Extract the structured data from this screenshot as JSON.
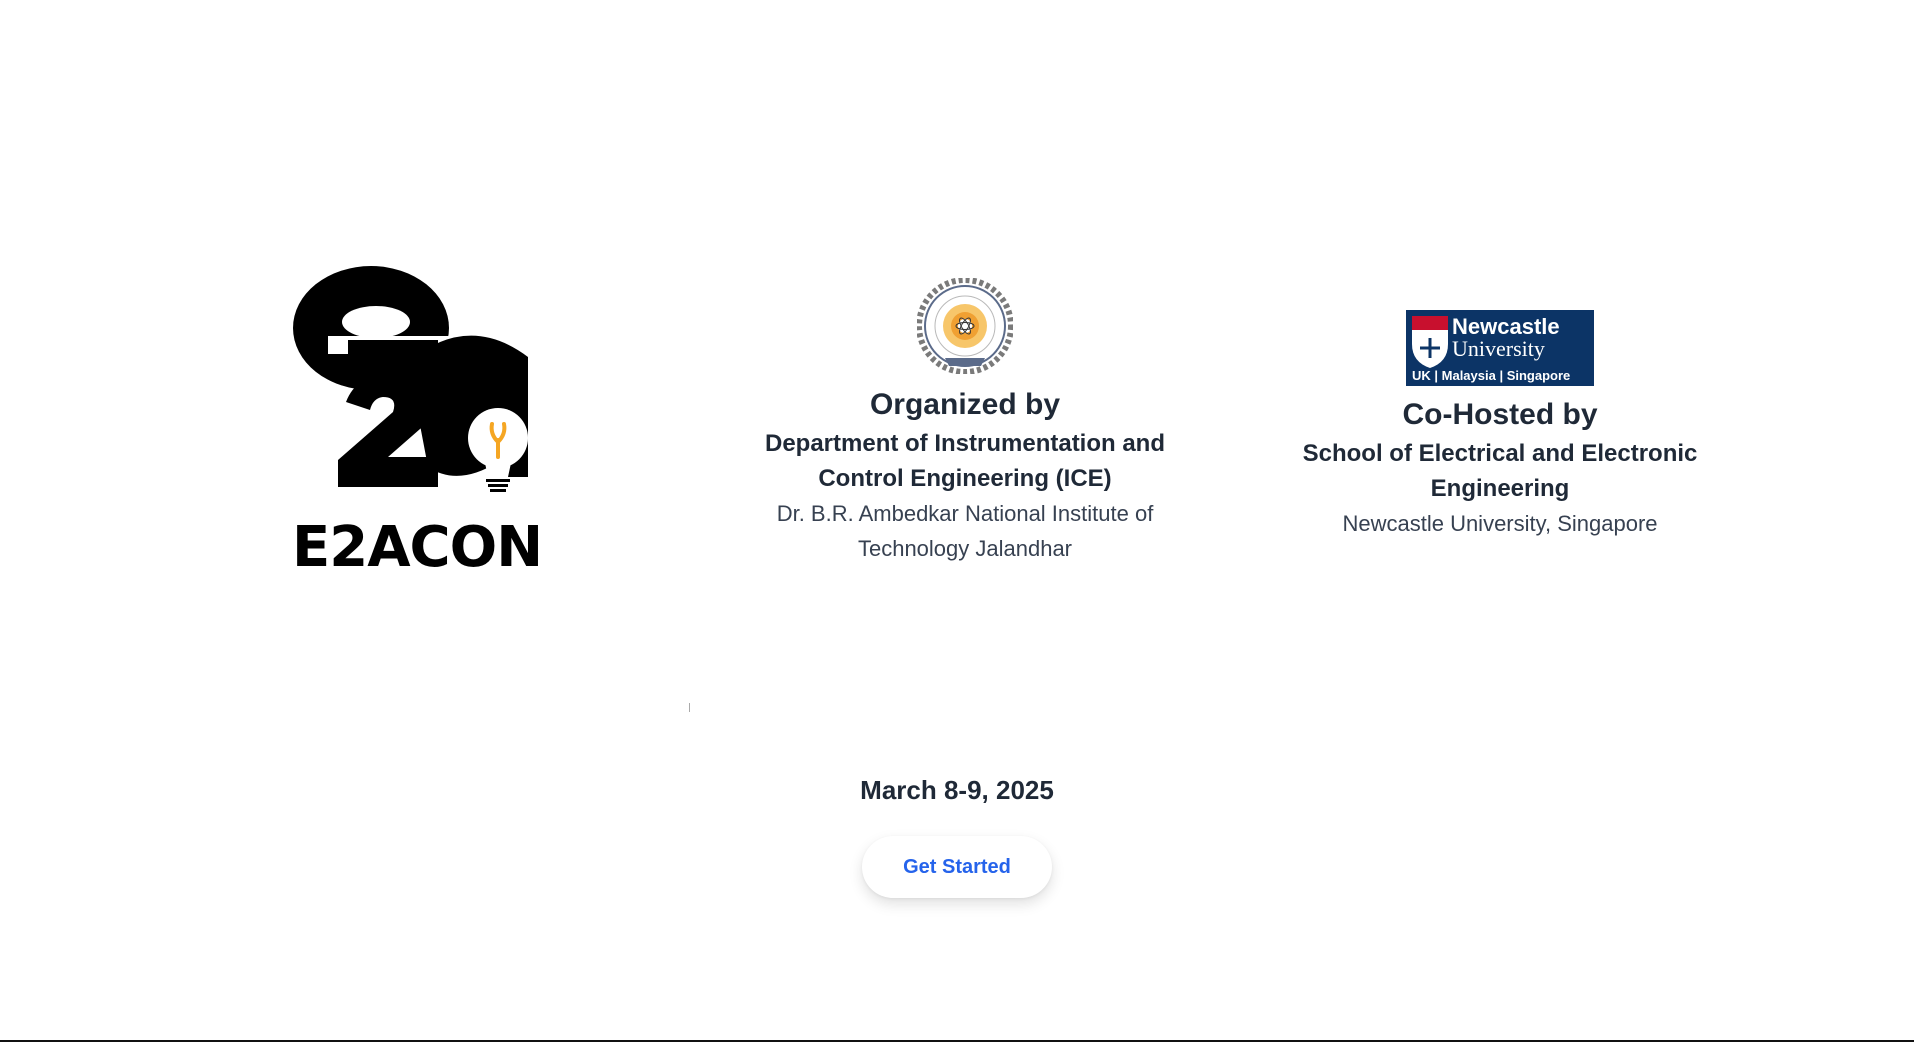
{
  "hero": {
    "logo_icon": "e2a-lightbulb-logo",
    "wordmark": "E2ACON"
  },
  "organizer": {
    "logo_icon": "nit-jalandhar-seal",
    "heading": "Organized by",
    "department": "Department of Instrumentation and Control Engineering (ICE)",
    "institute": "Dr. B.R. Ambedkar National Institute of Technology Jalandhar"
  },
  "cohost": {
    "logo_icon": "newcastle-university-logo",
    "logo_title": "Newcastle",
    "logo_subtitle": "University",
    "logo_regions": "UK | Malaysia | Singapore",
    "heading": "Co-Hosted by",
    "department": "School of Electrical and Electronic Engineering",
    "institute": "Newcastle University, Singapore"
  },
  "event": {
    "date": "March 8-9, 2025"
  },
  "cta": {
    "label": "Get Started"
  },
  "colors": {
    "accent": "#2563eb",
    "text": "#1f2937",
    "newcastle_navy": "#0c3466",
    "bulb_orange": "#f5a623"
  }
}
